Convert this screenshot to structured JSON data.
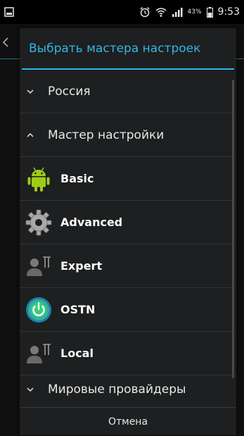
{
  "status_bar": {
    "battery_percent": "43%",
    "time": "9:53"
  },
  "dialog": {
    "title": "Выбрать мастера настроек",
    "groups": [
      {
        "label": "Россия",
        "expanded": false
      },
      {
        "label": "Мастер настройки",
        "expanded": true
      },
      {
        "label": "Мировые провайдеры",
        "expanded": false
      }
    ],
    "items": [
      {
        "label": "Basic",
        "icon": "android-icon"
      },
      {
        "label": "Advanced",
        "icon": "gear-icon"
      },
      {
        "label": "Expert",
        "icon": "user-tools-icon"
      },
      {
        "label": "OSTN",
        "icon": "power-globe-icon"
      },
      {
        "label": "Local",
        "icon": "user-tools-icon"
      }
    ],
    "cancel_label": "Отмена"
  },
  "colors": {
    "accent": "#33b5e5",
    "dialog_bg": "#1d1f20",
    "android_green": "#9fcb1a"
  }
}
